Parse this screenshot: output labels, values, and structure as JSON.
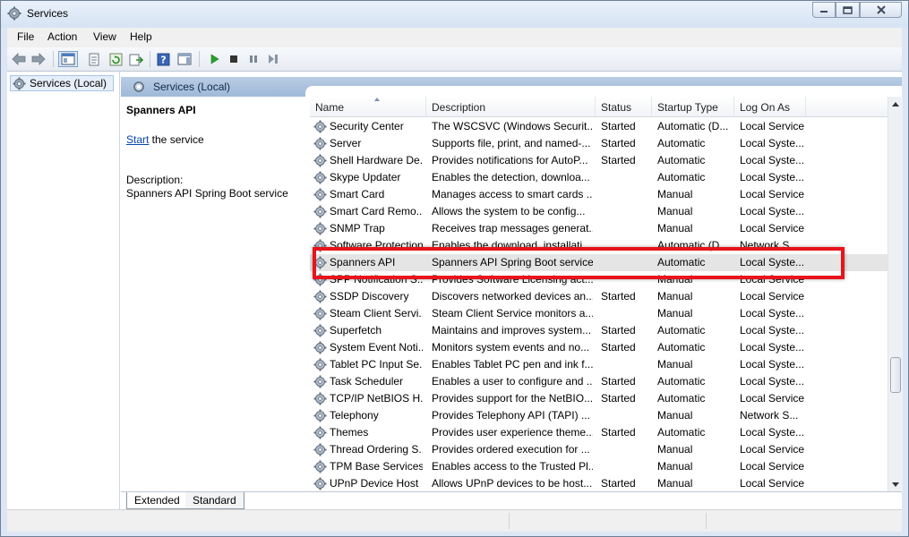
{
  "window": {
    "title": "Services"
  },
  "menu": [
    "File",
    "Action",
    "View",
    "Help"
  ],
  "tree": {
    "root_label": "Services (Local)"
  },
  "pane": {
    "header_title": "Services (Local)"
  },
  "detail": {
    "service_name": "Spanners API",
    "start_link": "Start",
    "start_suffix": " the service",
    "description_label": "Description:",
    "description_text": "Spanners API Spring Boot service"
  },
  "columns": [
    "Name",
    "Description",
    "Status",
    "Startup Type",
    "Log On As"
  ],
  "services": [
    {
      "name": "Security Center",
      "description": "The WSCSVC (Windows Securit...",
      "status": "Started",
      "startup": "Automatic (D...",
      "logon": "Local Service"
    },
    {
      "name": "Server",
      "description": "Supports file, print, and named-...",
      "status": "Started",
      "startup": "Automatic",
      "logon": "Local Syste..."
    },
    {
      "name": "Shell Hardware De...",
      "description": "Provides notifications for AutoP...",
      "status": "Started",
      "startup": "Automatic",
      "logon": "Local Syste..."
    },
    {
      "name": "Skype Updater",
      "description": "Enables the detection, downloa...",
      "status": "",
      "startup": "Automatic",
      "logon": "Local Syste..."
    },
    {
      "name": "Smart Card",
      "description": "Manages access to smart cards ...",
      "status": "",
      "startup": "Manual",
      "logon": "Local Service"
    },
    {
      "name": "Smart Card Remo...",
      "description": "Allows the system to be config...",
      "status": "",
      "startup": "Manual",
      "logon": "Local Syste..."
    },
    {
      "name": "SNMP Trap",
      "description": "Receives trap messages generat...",
      "status": "",
      "startup": "Manual",
      "logon": "Local Service"
    },
    {
      "name": "Software Protection",
      "description": "Enables the download, installati...",
      "status": "",
      "startup": "Automatic (D...",
      "logon": "Network S..."
    },
    {
      "name": "Spanners API",
      "description": "Spanners API Spring Boot service",
      "status": "",
      "startup": "Automatic",
      "logon": "Local Syste...",
      "selected": true
    },
    {
      "name": "SPP Notification S...",
      "description": "Provides Software Licensing act...",
      "status": "",
      "startup": "Manual",
      "logon": "Local Service"
    },
    {
      "name": "SSDP Discovery",
      "description": "Discovers networked devices an...",
      "status": "Started",
      "startup": "Manual",
      "logon": "Local Service"
    },
    {
      "name": "Steam Client Servi...",
      "description": "Steam Client Service monitors a...",
      "status": "",
      "startup": "Manual",
      "logon": "Local Syste..."
    },
    {
      "name": "Superfetch",
      "description": "Maintains and improves system...",
      "status": "Started",
      "startup": "Automatic",
      "logon": "Local Syste..."
    },
    {
      "name": "System Event Noti...",
      "description": "Monitors system events and no...",
      "status": "Started",
      "startup": "Automatic",
      "logon": "Local Syste..."
    },
    {
      "name": "Tablet PC Input Se...",
      "description": "Enables Tablet PC pen and ink f...",
      "status": "",
      "startup": "Manual",
      "logon": "Local Syste..."
    },
    {
      "name": "Task Scheduler",
      "description": "Enables a user to configure and ...",
      "status": "Started",
      "startup": "Automatic",
      "logon": "Local Syste..."
    },
    {
      "name": "TCP/IP NetBIOS H...",
      "description": "Provides support for the NetBIO...",
      "status": "Started",
      "startup": "Automatic",
      "logon": "Local Service"
    },
    {
      "name": "Telephony",
      "description": "Provides Telephony API (TAPI) ...",
      "status": "",
      "startup": "Manual",
      "logon": "Network S..."
    },
    {
      "name": "Themes",
      "description": "Provides user experience theme...",
      "status": "Started",
      "startup": "Automatic",
      "logon": "Local Syste..."
    },
    {
      "name": "Thread Ordering S...",
      "description": "Provides ordered execution for ...",
      "status": "",
      "startup": "Manual",
      "logon": "Local Service"
    },
    {
      "name": "TPM Base Services",
      "description": "Enables access to the Trusted Pl...",
      "status": "",
      "startup": "Manual",
      "logon": "Local Service"
    },
    {
      "name": "UPnP Device Host",
      "description": "Allows UPnP devices to be host...",
      "status": "Started",
      "startup": "Manual",
      "logon": "Local Service"
    }
  ],
  "tabs": [
    "Extended",
    "Standard"
  ],
  "colors": {
    "highlight": "#e8141a",
    "pane_header": "#a9c2de",
    "link": "#0645ad"
  }
}
